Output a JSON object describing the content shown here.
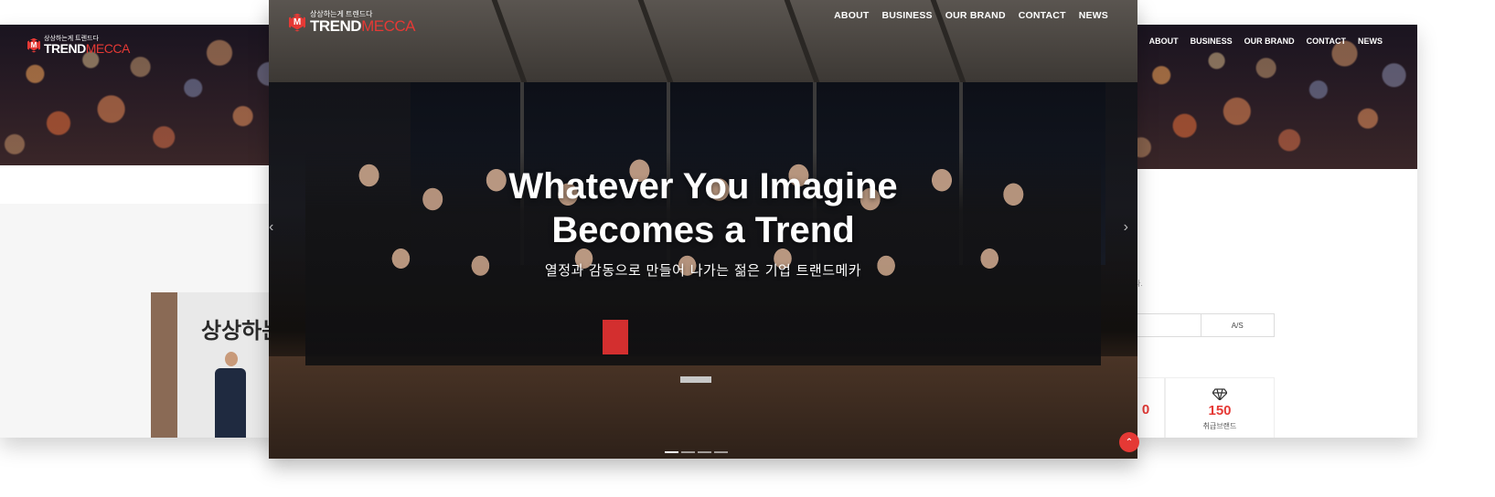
{
  "left_screen": {
    "logo": {
      "tagline": "상상하는게 트렌드다",
      "name_main": "TREND",
      "name_accent": "MECCA"
    },
    "photo_sign": "상상하는"
  },
  "main_screen": {
    "logo": {
      "tagline": "상상하는게 트렌드다",
      "name_main": "TREND",
      "name_accent": "MECCA"
    },
    "nav": [
      "ABOUT",
      "BUSINESS",
      "OUR BRAND",
      "CONTACT",
      "NEWS"
    ],
    "hero": {
      "title_line1": "Whatever You Imagine",
      "title_line2": "Becomes a Trend",
      "subtitle": "열정과 감동으로 만들어 나가는 젊은 기업 트랜드메카"
    },
    "arrows": {
      "prev": "‹",
      "next": "›"
    },
    "slide_indicator": {
      "count": 4,
      "active": 1
    }
  },
  "right_screen": {
    "nav": [
      "ABOUT",
      "BUSINESS",
      "OUR BRAND",
      "CONTACT",
      "NEWS"
    ],
    "note": "다.",
    "tabs": [
      "",
      "A/S"
    ],
    "stats": [
      {
        "number": "0",
        "label": ""
      },
      {
        "number": "150",
        "label": "취급브랜드",
        "icon": "diamond-icon"
      }
    ]
  },
  "scroll_top": {
    "icon": "chevron-up-icon",
    "glyph": "⌃"
  },
  "colors": {
    "accent": "#e53935",
    "text_light": "#ffffff"
  }
}
